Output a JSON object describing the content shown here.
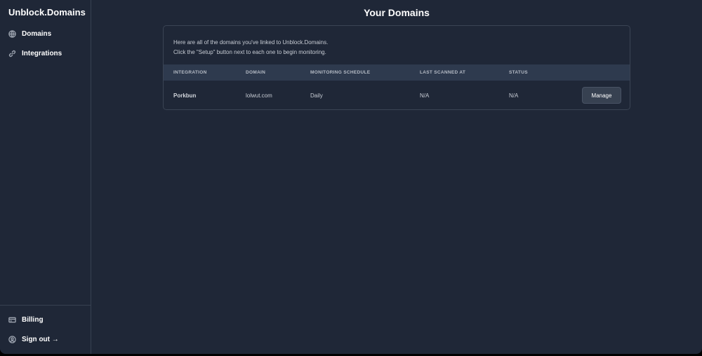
{
  "app": {
    "brand": "Unblock.Domains"
  },
  "sidebar": {
    "items": [
      {
        "label": "Domains",
        "icon": "globe-icon"
      },
      {
        "label": "Integrations",
        "icon": "link-icon"
      }
    ],
    "bottom": [
      {
        "label": "Billing",
        "icon": "credit-card-icon"
      },
      {
        "label": "Sign out →",
        "icon": "user-circle-icon"
      }
    ]
  },
  "main": {
    "title": "Your Domains",
    "intro": [
      "Here are all of the domains you've linked to Unblock.Domains.",
      "Click the \"Setup\" button next to each one to begin monitoring."
    ],
    "columns": [
      "INTEGRATION",
      "DOMAIN",
      "MONITORING SCHEDULE",
      "LAST SCANNED AT",
      "STATUS"
    ],
    "rows": [
      {
        "integration": "Porkbun",
        "domain": "lolwut.com",
        "schedule": "Daily",
        "last_scanned": "N/A",
        "status": "N/A",
        "action": "Manage"
      }
    ]
  }
}
